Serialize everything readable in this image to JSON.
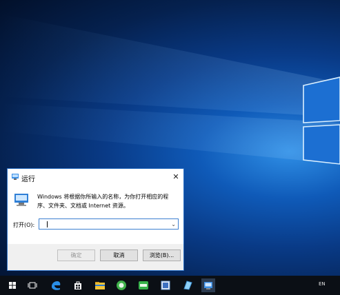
{
  "run_dialog": {
    "title": "运行",
    "close_icon": "close-icon",
    "description": "Windows 将根据你所输入的名称，为你打开相应的程序、文件夹、文档或 Internet 资源。",
    "open_label": "打开(O):",
    "open_value": "",
    "buttons": {
      "ok": "确定",
      "cancel": "取消",
      "browse": "浏览(B)..."
    }
  },
  "taskbar": {
    "icons": [
      "start-icon",
      "task-view-icon",
      "edge-icon",
      "store-icon",
      "file-explorer-icon",
      "green-app-icon",
      "iqiyi-icon",
      "media-app-icon",
      "blue-app-icon",
      "run-icon"
    ],
    "language": "EN"
  },
  "colors": {
    "taskbar": "#0b0f15",
    "dialog_border": "#2a6fc4",
    "wallpaper_glow": "#2f8fe6"
  }
}
